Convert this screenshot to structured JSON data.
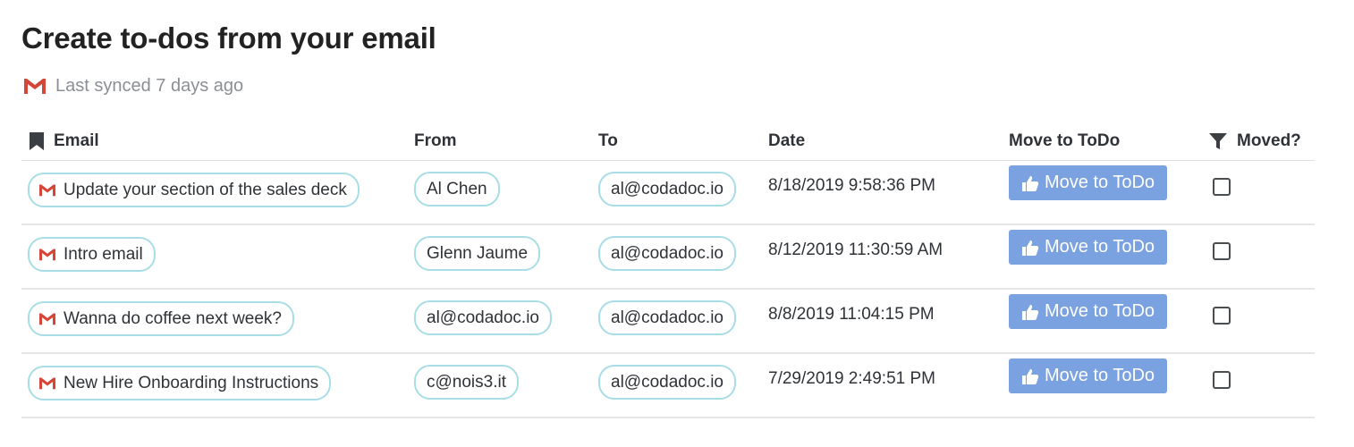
{
  "page": {
    "title": "Create to-dos from your email",
    "sync_status": "Last synced 7 days ago"
  },
  "table": {
    "columns": {
      "email": "Email",
      "from": "From",
      "to": "To",
      "date": "Date",
      "move": "Move to ToDo",
      "moved": "Moved?"
    },
    "rows": [
      {
        "subject": "Update your section of the sales deck",
        "from": "Al Chen",
        "to": "al@codadoc.io",
        "date": "8/18/2019 9:58:36 PM",
        "button": "Move to ToDo",
        "moved": false
      },
      {
        "subject": "Intro email",
        "from": "Glenn Jaume",
        "to": "al@codadoc.io",
        "date": "8/12/2019 11:30:59 AM",
        "button": "Move to ToDo",
        "moved": false
      },
      {
        "subject": "Wanna do coffee next week?",
        "from": "al@codadoc.io",
        "to": "al@codadoc.io",
        "date": "8/8/2019 11:04:15 PM",
        "button": "Move to ToDo",
        "moved": false
      },
      {
        "subject": "New Hire Onboarding Instructions",
        "from": "c@nois3.it",
        "to": "al@codadoc.io",
        "date": "7/29/2019 2:49:51 PM",
        "button": "Move to ToDo",
        "moved": false
      }
    ]
  },
  "colors": {
    "button_bg": "#7aa2e0",
    "chip_border": "#a9dde6",
    "gmail_red": "#d44638"
  },
  "icons": {
    "gmail": "gmail-icon",
    "bookmark": "bookmark-icon",
    "filter": "filter-icon",
    "thumbs_up": "thumbs-up-icon"
  }
}
